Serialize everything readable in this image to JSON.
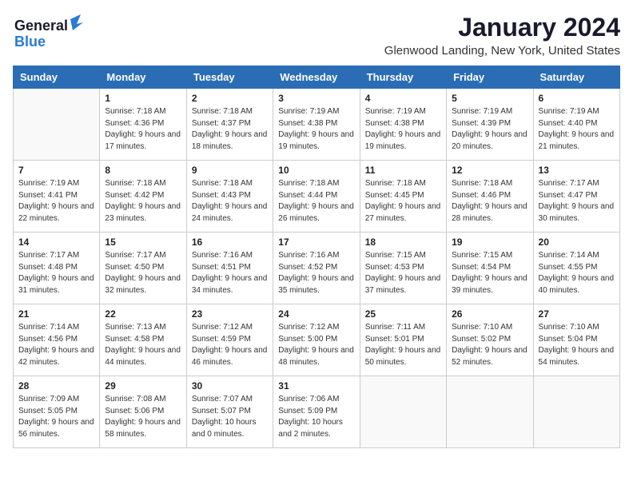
{
  "header": {
    "logo_general": "General",
    "logo_blue": "Blue",
    "month": "January 2024",
    "location": "Glenwood Landing, New York, United States"
  },
  "weekdays": [
    "Sunday",
    "Monday",
    "Tuesday",
    "Wednesday",
    "Thursday",
    "Friday",
    "Saturday"
  ],
  "weeks": [
    [
      {
        "date": "",
        "sunrise": "",
        "sunset": "",
        "daylight": ""
      },
      {
        "date": "1",
        "sunrise": "Sunrise: 7:18 AM",
        "sunset": "Sunset: 4:36 PM",
        "daylight": "Daylight: 9 hours and 17 minutes."
      },
      {
        "date": "2",
        "sunrise": "Sunrise: 7:18 AM",
        "sunset": "Sunset: 4:37 PM",
        "daylight": "Daylight: 9 hours and 18 minutes."
      },
      {
        "date": "3",
        "sunrise": "Sunrise: 7:19 AM",
        "sunset": "Sunset: 4:38 PM",
        "daylight": "Daylight: 9 hours and 19 minutes."
      },
      {
        "date": "4",
        "sunrise": "Sunrise: 7:19 AM",
        "sunset": "Sunset: 4:38 PM",
        "daylight": "Daylight: 9 hours and 19 minutes."
      },
      {
        "date": "5",
        "sunrise": "Sunrise: 7:19 AM",
        "sunset": "Sunset: 4:39 PM",
        "daylight": "Daylight: 9 hours and 20 minutes."
      },
      {
        "date": "6",
        "sunrise": "Sunrise: 7:19 AM",
        "sunset": "Sunset: 4:40 PM",
        "daylight": "Daylight: 9 hours and 21 minutes."
      }
    ],
    [
      {
        "date": "7",
        "sunrise": "Sunrise: 7:19 AM",
        "sunset": "Sunset: 4:41 PM",
        "daylight": "Daylight: 9 hours and 22 minutes."
      },
      {
        "date": "8",
        "sunrise": "Sunrise: 7:18 AM",
        "sunset": "Sunset: 4:42 PM",
        "daylight": "Daylight: 9 hours and 23 minutes."
      },
      {
        "date": "9",
        "sunrise": "Sunrise: 7:18 AM",
        "sunset": "Sunset: 4:43 PM",
        "daylight": "Daylight: 9 hours and 24 minutes."
      },
      {
        "date": "10",
        "sunrise": "Sunrise: 7:18 AM",
        "sunset": "Sunset: 4:44 PM",
        "daylight": "Daylight: 9 hours and 26 minutes."
      },
      {
        "date": "11",
        "sunrise": "Sunrise: 7:18 AM",
        "sunset": "Sunset: 4:45 PM",
        "daylight": "Daylight: 9 hours and 27 minutes."
      },
      {
        "date": "12",
        "sunrise": "Sunrise: 7:18 AM",
        "sunset": "Sunset: 4:46 PM",
        "daylight": "Daylight: 9 hours and 28 minutes."
      },
      {
        "date": "13",
        "sunrise": "Sunrise: 7:17 AM",
        "sunset": "Sunset: 4:47 PM",
        "daylight": "Daylight: 9 hours and 30 minutes."
      }
    ],
    [
      {
        "date": "14",
        "sunrise": "Sunrise: 7:17 AM",
        "sunset": "Sunset: 4:48 PM",
        "daylight": "Daylight: 9 hours and 31 minutes."
      },
      {
        "date": "15",
        "sunrise": "Sunrise: 7:17 AM",
        "sunset": "Sunset: 4:50 PM",
        "daylight": "Daylight: 9 hours and 32 minutes."
      },
      {
        "date": "16",
        "sunrise": "Sunrise: 7:16 AM",
        "sunset": "Sunset: 4:51 PM",
        "daylight": "Daylight: 9 hours and 34 minutes."
      },
      {
        "date": "17",
        "sunrise": "Sunrise: 7:16 AM",
        "sunset": "Sunset: 4:52 PM",
        "daylight": "Daylight: 9 hours and 35 minutes."
      },
      {
        "date": "18",
        "sunrise": "Sunrise: 7:15 AM",
        "sunset": "Sunset: 4:53 PM",
        "daylight": "Daylight: 9 hours and 37 minutes."
      },
      {
        "date": "19",
        "sunrise": "Sunrise: 7:15 AM",
        "sunset": "Sunset: 4:54 PM",
        "daylight": "Daylight: 9 hours and 39 minutes."
      },
      {
        "date": "20",
        "sunrise": "Sunrise: 7:14 AM",
        "sunset": "Sunset: 4:55 PM",
        "daylight": "Daylight: 9 hours and 40 minutes."
      }
    ],
    [
      {
        "date": "21",
        "sunrise": "Sunrise: 7:14 AM",
        "sunset": "Sunset: 4:56 PM",
        "daylight": "Daylight: 9 hours and 42 minutes."
      },
      {
        "date": "22",
        "sunrise": "Sunrise: 7:13 AM",
        "sunset": "Sunset: 4:58 PM",
        "daylight": "Daylight: 9 hours and 44 minutes."
      },
      {
        "date": "23",
        "sunrise": "Sunrise: 7:12 AM",
        "sunset": "Sunset: 4:59 PM",
        "daylight": "Daylight: 9 hours and 46 minutes."
      },
      {
        "date": "24",
        "sunrise": "Sunrise: 7:12 AM",
        "sunset": "Sunset: 5:00 PM",
        "daylight": "Daylight: 9 hours and 48 minutes."
      },
      {
        "date": "25",
        "sunrise": "Sunrise: 7:11 AM",
        "sunset": "Sunset: 5:01 PM",
        "daylight": "Daylight: 9 hours and 50 minutes."
      },
      {
        "date": "26",
        "sunrise": "Sunrise: 7:10 AM",
        "sunset": "Sunset: 5:02 PM",
        "daylight": "Daylight: 9 hours and 52 minutes."
      },
      {
        "date": "27",
        "sunrise": "Sunrise: 7:10 AM",
        "sunset": "Sunset: 5:04 PM",
        "daylight": "Daylight: 9 hours and 54 minutes."
      }
    ],
    [
      {
        "date": "28",
        "sunrise": "Sunrise: 7:09 AM",
        "sunset": "Sunset: 5:05 PM",
        "daylight": "Daylight: 9 hours and 56 minutes."
      },
      {
        "date": "29",
        "sunrise": "Sunrise: 7:08 AM",
        "sunset": "Sunset: 5:06 PM",
        "daylight": "Daylight: 9 hours and 58 minutes."
      },
      {
        "date": "30",
        "sunrise": "Sunrise: 7:07 AM",
        "sunset": "Sunset: 5:07 PM",
        "daylight": "Daylight: 10 hours and 0 minutes."
      },
      {
        "date": "31",
        "sunrise": "Sunrise: 7:06 AM",
        "sunset": "Sunset: 5:09 PM",
        "daylight": "Daylight: 10 hours and 2 minutes."
      },
      {
        "date": "",
        "sunrise": "",
        "sunset": "",
        "daylight": ""
      },
      {
        "date": "",
        "sunrise": "",
        "sunset": "",
        "daylight": ""
      },
      {
        "date": "",
        "sunrise": "",
        "sunset": "",
        "daylight": ""
      }
    ]
  ]
}
